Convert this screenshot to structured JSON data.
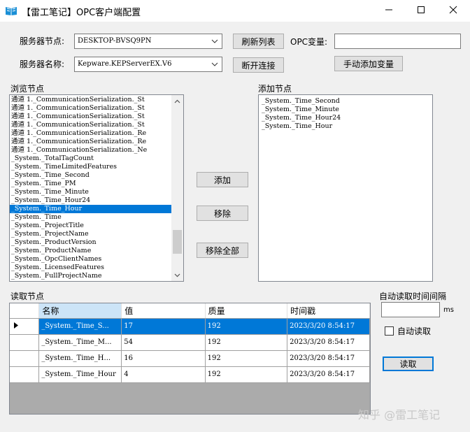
{
  "window": {
    "title": "【雷工笔记】OPC客户端配置",
    "controls": [
      "minimize-icon",
      "maximize-icon",
      "close-icon"
    ]
  },
  "top": {
    "server_node_label": "服务器节点:",
    "server_node_value": "DESKTOP-BVSQ9PN",
    "refresh_button": "刷新列表",
    "opc_var_label": "OPC变量:",
    "opc_var_value": "",
    "server_name_label": "服务器名称:",
    "server_name_value": "Kepware.KEPServerEX.V6",
    "disconnect_button": "断开连接",
    "manual_add_button": "手动添加变量"
  },
  "browse": {
    "label": "浏览节点",
    "items": [
      "通道 1._CommunicationSerialization._St",
      "通道 1._CommunicationSerialization._St",
      "通道 1._CommunicationSerialization._St",
      "通道 1._CommunicationSerialization._St",
      "通道 1._CommunicationSerialization._Re",
      "通道 1._CommunicationSerialization._Re",
      "通道 1._CommunicationSerialization._Ne",
      "_System._TotalTagCount",
      "_System._TimeLimitedFeatures",
      "_System._Time_Second",
      "_System._Time_PM",
      "_System._Time_Minute",
      "_System._Time_Hour24",
      "_System._Time_Hour",
      "_System._Time",
      "_System._ProjectTitle",
      "_System._ProjectName",
      "_System._ProductVersion",
      "_System._ProductName",
      "_System._OpcClientNames",
      "_System._LicensedFeatures",
      "_System._FullProjectName"
    ],
    "selected_index": 13
  },
  "middle_buttons": {
    "add": "添加",
    "remove": "移除",
    "remove_all": "移除全部"
  },
  "added": {
    "label": "添加节点",
    "items": [
      "_System._Time_Second",
      "_System._Time_Minute",
      "_System._Time_Hour24",
      "_System._Time_Hour"
    ]
  },
  "read": {
    "label": "读取节点",
    "columns": [
      "名称",
      "值",
      "质量",
      "时间戳"
    ],
    "rows": [
      {
        "name": "_System._Time_S...",
        "value": "17",
        "quality": "192",
        "timestamp": "2023/3/20 8:54:17"
      },
      {
        "name": "_System._Time_M...",
        "value": "54",
        "quality": "192",
        "timestamp": "2023/3/20 8:54:17"
      },
      {
        "name": "_System._Time_H...",
        "value": "16",
        "quality": "192",
        "timestamp": "2023/3/20 8:54:17"
      },
      {
        "name": "_System._Time_Hour",
        "value": "4",
        "quality": "192",
        "timestamp": "2023/3/20 8:54:17"
      }
    ],
    "selected_row": 0
  },
  "auto": {
    "interval_label": "自动读取时间间隔",
    "interval_value": "",
    "unit": "ms",
    "auto_read_label": "自动读取",
    "auto_read_checked": false,
    "read_button": "读取"
  },
  "watermark": "知乎 @雷工笔记",
  "colors": {
    "selection": "#0078d7",
    "window_bg": "#f0f0f0",
    "grid_bg": "#ababab"
  }
}
